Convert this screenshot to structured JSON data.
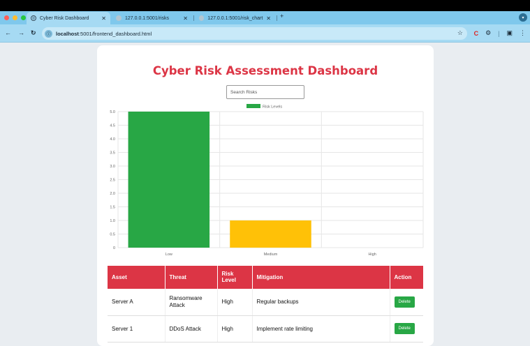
{
  "browser": {
    "tabs": [
      {
        "label": "Cyber Risk Dashboard",
        "active": true
      },
      {
        "label": "127.0.0.1:5001/risks",
        "active": false
      },
      {
        "label": "127.0.0.1:5001/risk_chart",
        "active": false
      }
    ],
    "url_host": "localhost",
    "url_path": ":5001/frontend_dashboard.html"
  },
  "page": {
    "title": "Cyber Risk Assessment Dashboard",
    "search_placeholder": "Search Risks"
  },
  "chart_data": {
    "type": "bar",
    "categories": [
      "Low",
      "Medium",
      "High"
    ],
    "series": [
      {
        "name": "Risk Levels",
        "values": [
          5,
          1,
          0
        ],
        "colors": [
          "#28a745",
          "#ffc107",
          "#dc3545"
        ]
      }
    ],
    "yticks": [
      "0",
      "0.5",
      "1.0",
      "1.5",
      "2.0",
      "2.5",
      "3.0",
      "3.5",
      "4.0",
      "4.5",
      "5.0"
    ],
    "ylim": [
      0,
      5
    ],
    "legend": "top-center",
    "grid": true
  },
  "table": {
    "headers": [
      "Asset",
      "Threat",
      "Risk Level",
      "Mitigation",
      "Action"
    ],
    "rows": [
      {
        "asset": "Server A",
        "threat": "Ransomware Attack",
        "level": "High",
        "mitigation": "Regular backups",
        "action": "Delete"
      },
      {
        "asset": "Server 1",
        "threat": "DDoS Attack",
        "level": "High",
        "mitigation": "Implement rate limiting",
        "action": "Delete"
      }
    ]
  },
  "colors": {
    "accent": "#dc3545",
    "success": "#28a745",
    "warning": "#ffc107"
  }
}
